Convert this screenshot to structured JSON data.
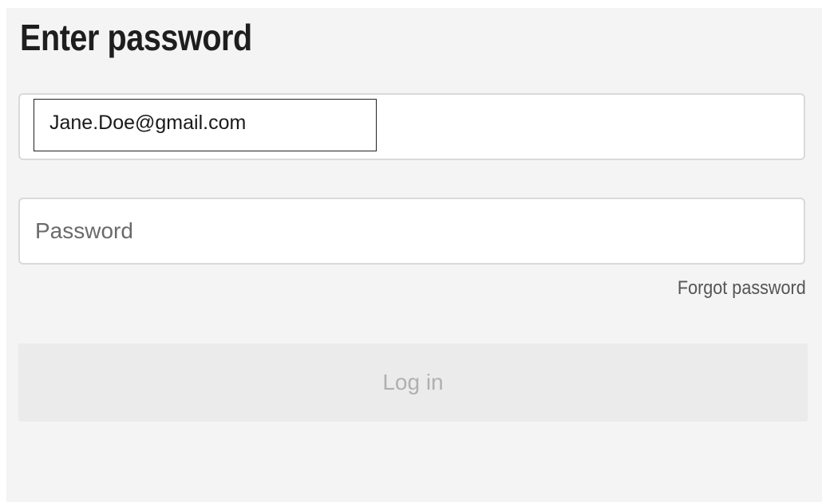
{
  "page": {
    "title": "Enter password"
  },
  "email_field": {
    "value": "Jane.Doe@gmail.com"
  },
  "password_field": {
    "placeholder": "Password",
    "value": ""
  },
  "links": {
    "forgot_password": "Forgot password"
  },
  "login_button": {
    "label": "Log in",
    "state": "disabled"
  },
  "colors": {
    "panel_background": "#f4f4f4",
    "field_background": "#ffffff",
    "field_border": "#d9d9d9",
    "title_text": "#1e1e1e",
    "button_background": "#ebebeb",
    "button_text_disabled": "#b0b0b0"
  }
}
